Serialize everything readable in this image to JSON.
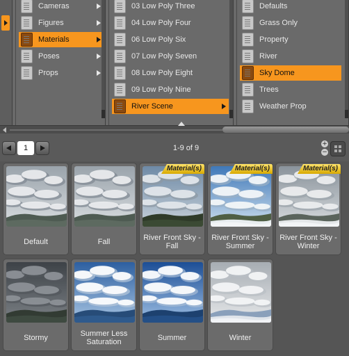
{
  "column1": {
    "items": [
      {
        "label": "Cameras",
        "has_submenu": true,
        "selected": false
      },
      {
        "label": "Figures",
        "has_submenu": true,
        "selected": false
      },
      {
        "label": "Materials",
        "has_submenu": true,
        "selected": true
      },
      {
        "label": "Poses",
        "has_submenu": true,
        "selected": false
      },
      {
        "label": "Props",
        "has_submenu": true,
        "selected": false
      }
    ]
  },
  "column2": {
    "items": [
      {
        "label": "03 Low Poly Three",
        "selected": false
      },
      {
        "label": "04 Low Poly Four",
        "selected": false
      },
      {
        "label": "06 Low Poly Six",
        "selected": false
      },
      {
        "label": "07 Low Poly Seven",
        "selected": false
      },
      {
        "label": "08 Low Poly Eight",
        "selected": false
      },
      {
        "label": "09 Low Poly Nine",
        "selected": false
      },
      {
        "label": "River Scene",
        "selected": true,
        "has_submenu": true
      }
    ]
  },
  "column3": {
    "items": [
      {
        "label": "Defaults",
        "selected": false
      },
      {
        "label": "Grass Only",
        "selected": false
      },
      {
        "label": "Property",
        "selected": false
      },
      {
        "label": "River",
        "selected": false
      },
      {
        "label": "Sky Dome",
        "selected": true
      },
      {
        "label": "Trees",
        "selected": false
      },
      {
        "label": "Weather Prop",
        "selected": false
      }
    ]
  },
  "pager": {
    "current_page": "1",
    "count_label": "1-9 of 9",
    "zoom_in": "+",
    "zoom_out": "−"
  },
  "thumbnails": [
    {
      "caption": "Default",
      "badge": "",
      "scene": "cloudy"
    },
    {
      "caption": "Fall",
      "badge": "",
      "scene": "cloudy"
    },
    {
      "caption": "River Front Sky - Fall",
      "badge": "Material(s)",
      "scene": "river"
    },
    {
      "caption": "River Front Sky - Summer",
      "badge": "Material(s)",
      "scene": "river-bright"
    },
    {
      "caption": "River Front Sky - Winter",
      "badge": "Material(s)",
      "scene": "river-snow"
    },
    {
      "caption": "Stormy",
      "badge": "",
      "scene": "stormy"
    },
    {
      "caption": "Summer Less Saturation",
      "badge": "",
      "scene": "summer-pale"
    },
    {
      "caption": "Summer",
      "badge": "",
      "scene": "summer"
    },
    {
      "caption": "Winter",
      "badge": "",
      "scene": "winter"
    }
  ],
  "colors": {
    "selection": "#f7961e",
    "panel": "#6a6a6a",
    "background": "#555555",
    "badge": "#f5c518"
  }
}
